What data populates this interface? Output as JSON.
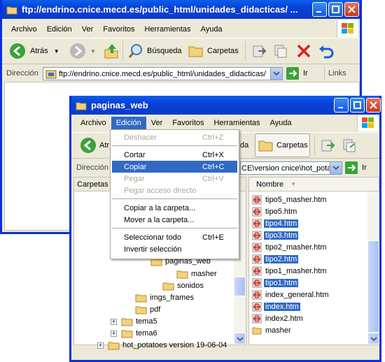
{
  "back_window": {
    "title": "ftp://endrino.cnice.mecd.es/public_html/unidades_didacticas/ ...",
    "menu": [
      "Archivo",
      "Edición",
      "Ver",
      "Favoritos",
      "Herramientas",
      "Ayuda"
    ],
    "toolbar": {
      "back": "Atrás",
      "search": "Búsqueda",
      "folders": "Carpetas"
    },
    "address_label": "Dirección",
    "address_value": "ftp://endrino.cnice.mecd.es/public_html/unidades_didacticas/",
    "go": "Ir",
    "links": "Links"
  },
  "front_window": {
    "title": "paginas_web",
    "menu": [
      "Archivo",
      "Edición",
      "Ver",
      "Favoritos",
      "Herramientas",
      "Ayuda"
    ],
    "toolbar": {
      "back": "Atrás",
      "folders_partial": "da",
      "folders": "Carpetas"
    },
    "address_label": "Dirección",
    "address_value": "CE\\version cnice\\hot_pota",
    "go": "Ir",
    "folders_header": "Carpetas",
    "name_header": "Nombre",
    "tree": [
      {
        "label": "paginas_web"
      },
      {
        "label": "masher"
      },
      {
        "label": "sonidos"
      },
      {
        "label": "imgs_frames"
      },
      {
        "label": "pdf"
      },
      {
        "label": "tema5"
      },
      {
        "label": "tema6"
      },
      {
        "label": "hot_potatoes version 19-06-04"
      }
    ],
    "files": [
      {
        "name": "tipo5_masher.htm",
        "selected": false
      },
      {
        "name": "tipo5.htm",
        "selected": false
      },
      {
        "name": "tipo4.htm",
        "selected": true
      },
      {
        "name": "tipo3.htm",
        "selected": true
      },
      {
        "name": "tipo2_masher.htm",
        "selected": false
      },
      {
        "name": "tipo2.htm",
        "selected": true
      },
      {
        "name": "tipo1_masher.htm",
        "selected": false
      },
      {
        "name": "tipo1.htm",
        "selected": true
      },
      {
        "name": "index_general.htm",
        "selected": false
      },
      {
        "name": "index.htm",
        "selected": true
      },
      {
        "name": "index2.htm",
        "selected": false
      },
      {
        "name": "masher",
        "selected": false
      }
    ]
  },
  "edit_menu": {
    "items": [
      {
        "label": "Deshacer",
        "shortcut": "Ctrl+Z",
        "disabled": true
      },
      {
        "sep": true
      },
      {
        "label": "Cortar",
        "shortcut": "Ctrl+X",
        "disabled": false
      },
      {
        "label": "Copiar",
        "shortcut": "Ctrl+C",
        "disabled": false,
        "highlight": true
      },
      {
        "label": "Pegar",
        "shortcut": "Ctrl+V",
        "disabled": true
      },
      {
        "label": "Pegar acceso directo",
        "shortcut": "",
        "disabled": true
      },
      {
        "sep": true
      },
      {
        "label": "Copiar a la carpeta...",
        "shortcut": "",
        "disabled": false
      },
      {
        "label": "Mover a la carpeta...",
        "shortcut": "",
        "disabled": false
      },
      {
        "sep": true
      },
      {
        "label": "Seleccionar todo",
        "shortcut": "Ctrl+E",
        "disabled": false
      },
      {
        "label": "Invertir selección",
        "shortcut": "",
        "disabled": false
      }
    ]
  },
  "colors": {
    "titlebar": "#0a50e0",
    "selection": "#316ac5",
    "chrome": "#ece9d8"
  }
}
